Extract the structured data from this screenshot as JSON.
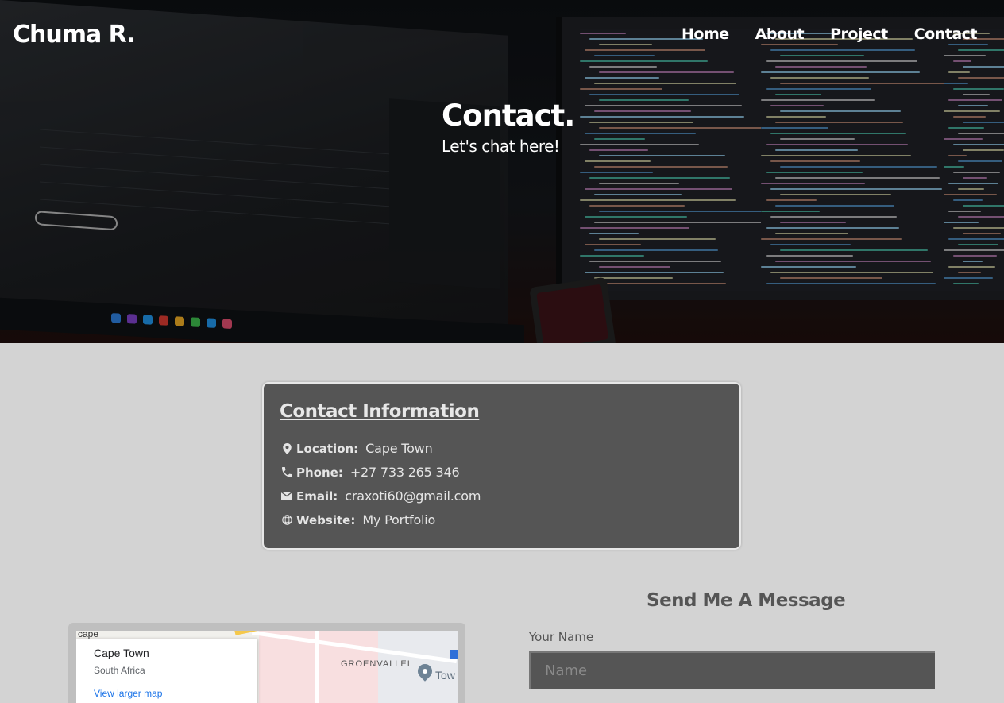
{
  "brand": {
    "name": "Chuma R."
  },
  "nav": {
    "items": [
      {
        "label": "Home"
      },
      {
        "label": "About"
      },
      {
        "label": "Project"
      },
      {
        "label": "Contact"
      }
    ]
  },
  "hero": {
    "title": "Contact.",
    "subtitle": "Let's chat here!"
  },
  "contact_info": {
    "title": "Contact Information",
    "items": [
      {
        "icon": "location-pin-icon",
        "label": "Location:",
        "value": "Cape Town"
      },
      {
        "icon": "phone-icon",
        "label": "Phone:",
        "value": "+27 733 265 346"
      },
      {
        "icon": "email-icon",
        "label": "Email:",
        "value": "craxoti60@gmail.com"
      },
      {
        "icon": "globe-icon",
        "label": "Website:",
        "value": "My Portfolio"
      }
    ]
  },
  "map": {
    "place_title": "Cape Town",
    "place_subtitle": "South Africa",
    "larger_map_link": "View larger map",
    "labels": {
      "corner": "cape",
      "area": "GROENVALLEI",
      "town": "Tow"
    }
  },
  "form": {
    "title": "Send Me A Message",
    "name_label": "Your Name",
    "name_placeholder": "Name"
  },
  "colors": {
    "card_bg": "#555555",
    "page_bg": "#d3d3d3",
    "link_blue": "#1a73e8"
  }
}
